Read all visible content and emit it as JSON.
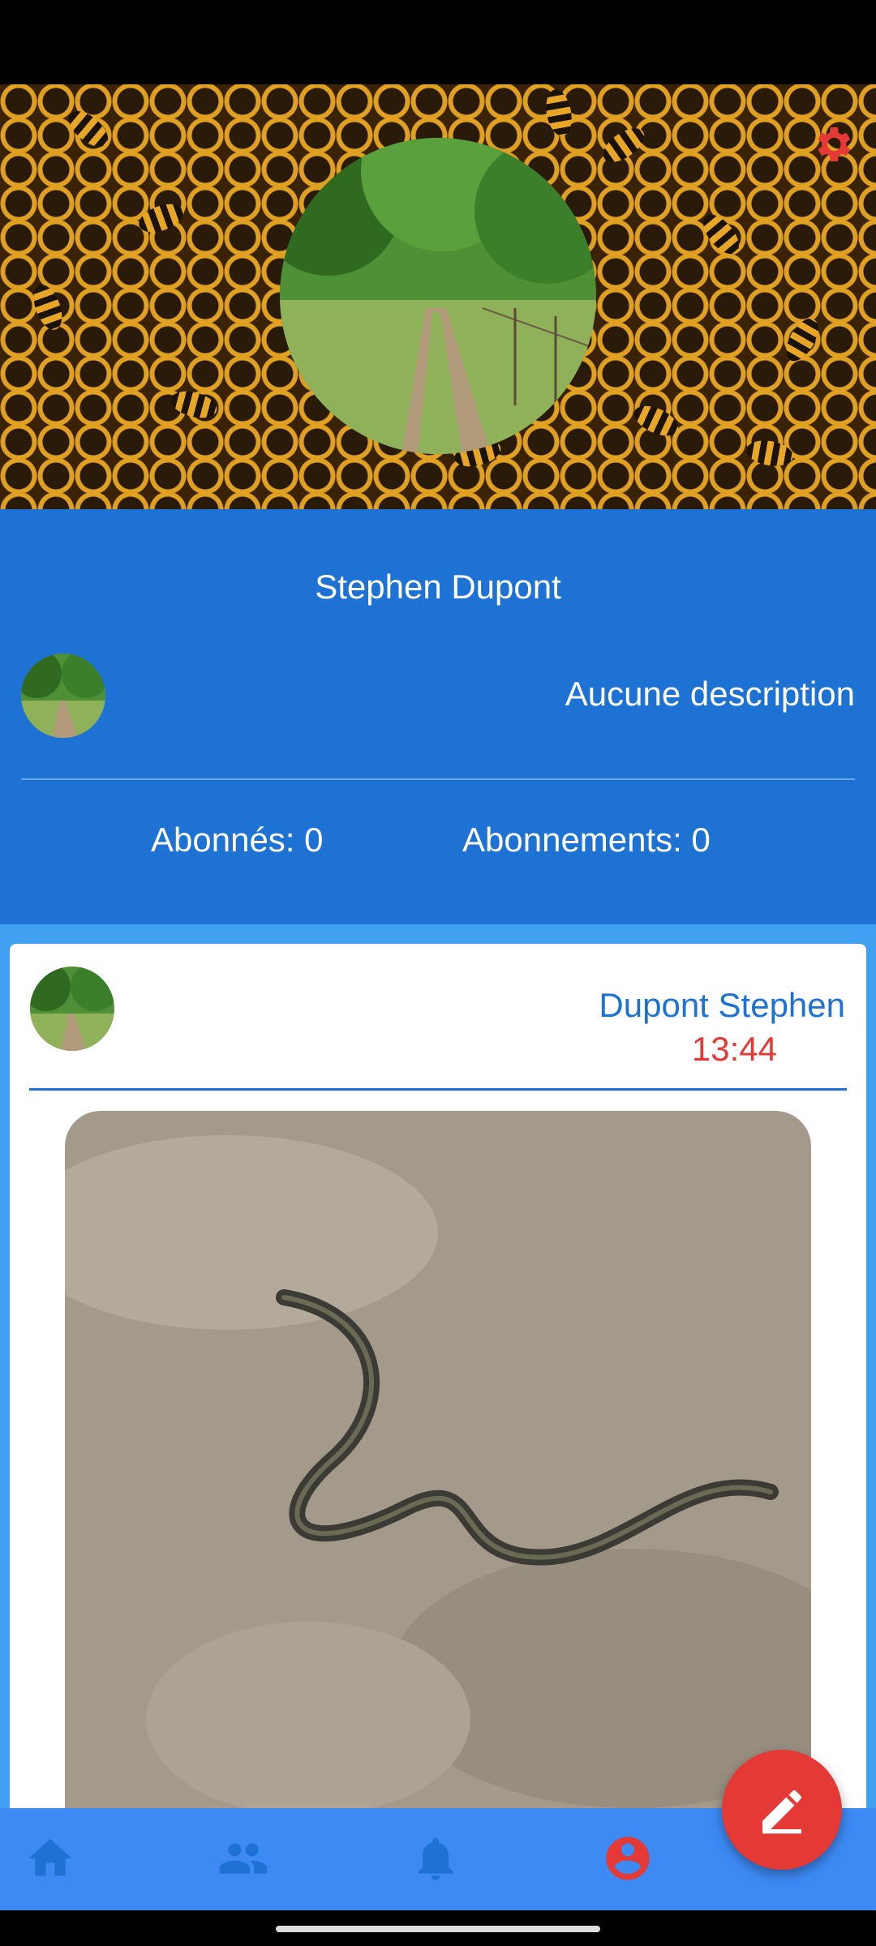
{
  "profile": {
    "name": "Stephen Dupont",
    "description": "Aucune description",
    "followers_label": "Abonnés: 0",
    "following_label": "Abonnements: 0"
  },
  "post": {
    "author": "Dupont Stephen",
    "time": "13:44"
  },
  "icons": {
    "settings": "gear-icon",
    "nav": [
      "home-icon",
      "people-icon",
      "bell-icon",
      "account-circle-icon"
    ],
    "fab": "edit-icon"
  },
  "colors": {
    "header_blue": "#1d72d3",
    "feed_blue": "#42a0f3",
    "nav_blue": "#3d8af5",
    "accent_red": "#e53935"
  }
}
